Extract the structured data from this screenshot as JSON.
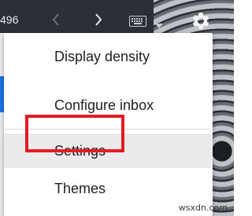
{
  "toolbar": {
    "message_count": "496",
    "icons": [
      "chevron-left-icon",
      "chevron-right-icon",
      "keyboard-icon",
      "chevron-down-icon",
      "gear-icon"
    ]
  },
  "settings_menu": {
    "items": [
      {
        "label": "Display density"
      },
      {
        "label": "Configure inbox"
      },
      {
        "label": "Settings"
      },
      {
        "label": "Themes"
      }
    ],
    "highlighted": "Settings"
  },
  "colors": {
    "highlight_box": "#e31b23",
    "menu_background": "#ffffff",
    "accent": "#1a73e8"
  },
  "watermark": "wsxdn.com"
}
